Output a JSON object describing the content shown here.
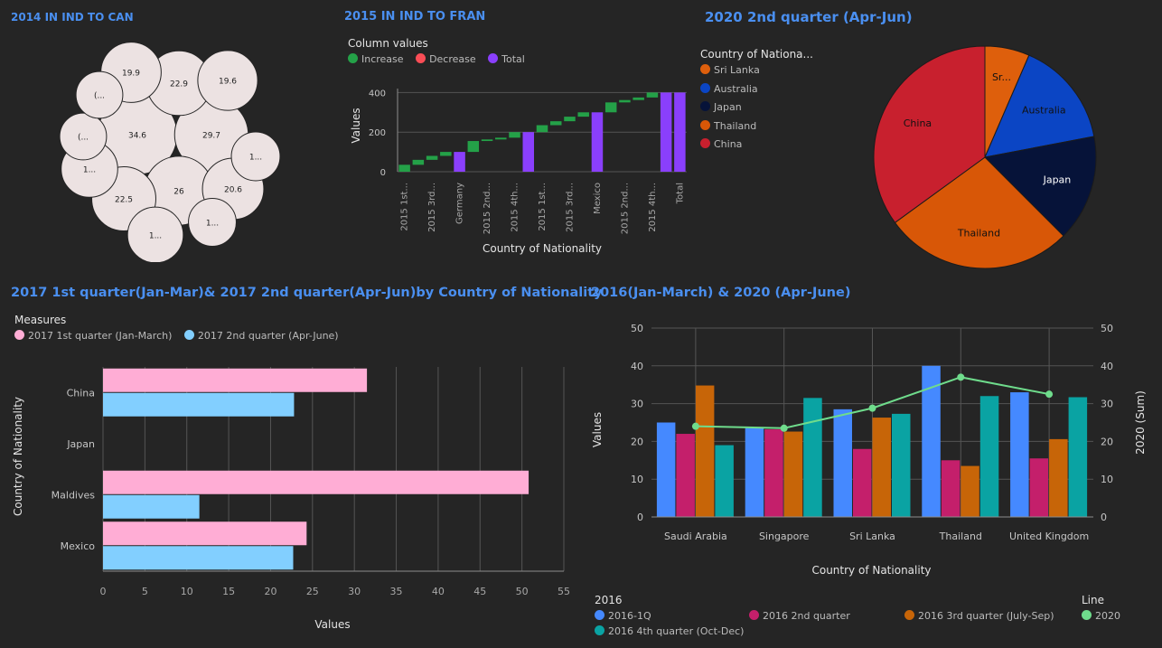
{
  "panels": {
    "bubble": {
      "title": "2014 IN IND TO CAN"
    },
    "waterfall": {
      "title": "2015 IN IND TO FRAN"
    },
    "pie": {
      "title": "2020 2nd quarter (Apr-Jun)"
    },
    "hbar": {
      "title": "2017 1st quarter(Jan-Mar)& 2017 2nd quarter(Apr-Jun)by Country of Nationality"
    },
    "combo": {
      "title": "2016(Jan-March) & 2020  (Apr-June)"
    }
  },
  "chart_data": [
    {
      "id": "bubble",
      "type": "bubble",
      "title": "2014 IN IND TO CAN",
      "bubble_fill": "#ece2e2",
      "bubbles": [
        {
          "label": "34.6",
          "value": 34.6
        },
        {
          "label": "29.7",
          "value": 29.7
        },
        {
          "label": "26",
          "value": 26
        },
        {
          "label": "22.9",
          "value": 22.9
        },
        {
          "label": "22.5",
          "value": 22.5
        },
        {
          "label": "20.6",
          "value": 20.6
        },
        {
          "label": "19.9",
          "value": 19.9
        },
        {
          "label": "19.6",
          "value": 19.6
        },
        {
          "label": "1...",
          "value": 17.5
        },
        {
          "label": "1...",
          "value": 17.0
        },
        {
          "label": "1...",
          "value": 13.0
        },
        {
          "label": "1...",
          "value": 12.5
        },
        {
          "label": "(...",
          "value": 12.0
        },
        {
          "label": "(...",
          "value": 12.0
        }
      ]
    },
    {
      "id": "waterfall",
      "type": "bar",
      "subtype": "waterfall",
      "title": "2015 IN IND TO FRAN",
      "xlabel": "Country of Nationality",
      "ylabel": "Values",
      "ylim": [
        0,
        420
      ],
      "yticks": [
        0,
        200,
        400
      ],
      "legend_title": "Column values",
      "legend": [
        {
          "name": "Increase",
          "color": "#24a148"
        },
        {
          "name": "Decrease",
          "color": "#fa4d56"
        },
        {
          "name": "Total",
          "color": "#8a3ffc"
        }
      ],
      "bars": [
        {
          "kind": "inc",
          "from": 0,
          "to": 35
        },
        {
          "kind": "inc",
          "from": 35,
          "to": 60
        },
        {
          "kind": "inc",
          "from": 60,
          "to": 80
        },
        {
          "kind": "inc",
          "from": 80,
          "to": 100
        },
        {
          "kind": "total",
          "from": 0,
          "to": 100
        },
        {
          "kind": "inc",
          "from": 100,
          "to": 155
        },
        {
          "kind": "inc",
          "from": 155,
          "to": 163
        },
        {
          "kind": "inc",
          "from": 163,
          "to": 172
        },
        {
          "kind": "inc",
          "from": 172,
          "to": 200
        },
        {
          "kind": "total",
          "from": 0,
          "to": 200
        },
        {
          "kind": "inc",
          "from": 200,
          "to": 235
        },
        {
          "kind": "inc",
          "from": 235,
          "to": 255
        },
        {
          "kind": "inc",
          "from": 255,
          "to": 278
        },
        {
          "kind": "inc",
          "from": 278,
          "to": 300
        },
        {
          "kind": "total",
          "from": 0,
          "to": 300
        },
        {
          "kind": "inc",
          "from": 300,
          "to": 350
        },
        {
          "kind": "inc",
          "from": 350,
          "to": 362
        },
        {
          "kind": "inc",
          "from": 362,
          "to": 375
        },
        {
          "kind": "inc",
          "from": 375,
          "to": 400
        },
        {
          "kind": "total",
          "from": 0,
          "to": 400
        },
        {
          "kind": "total",
          "from": 0,
          "to": 400
        }
      ],
      "tick_labels": [
        {
          "i": 0,
          "label": "2015 1st..."
        },
        {
          "i": 2,
          "label": "2015 3rd..."
        },
        {
          "i": 4,
          "label": "Germany"
        },
        {
          "i": 6,
          "label": "2015 2nd..."
        },
        {
          "i": 8,
          "label": "2015 4th..."
        },
        {
          "i": 10,
          "label": "2015 1st..."
        },
        {
          "i": 12,
          "label": "2015 3rd..."
        },
        {
          "i": 14,
          "label": "Mexico"
        },
        {
          "i": 16,
          "label": "2015 2nd..."
        },
        {
          "i": 18,
          "label": "2015 4th..."
        },
        {
          "i": 20,
          "label": "Total"
        }
      ]
    },
    {
      "id": "pie",
      "type": "pie",
      "title": "2020 2nd quarter (Apr-Jun)",
      "legend_title": "Country of Nationa...",
      "slices": [
        {
          "name": "Sri Lanka",
          "label": "Sr...",
          "value": 6.5,
          "color": "#de5f0c"
        },
        {
          "name": "Australia",
          "label": "Australia",
          "value": 15.5,
          "color": "#0b45c4"
        },
        {
          "name": "Japan",
          "label": "Japan",
          "value": 15.5,
          "color": "#061339"
        },
        {
          "name": "Thailand",
          "label": "Thailand",
          "value": 27.5,
          "color": "#d85707"
        },
        {
          "name": "China",
          "label": "China",
          "value": 35.0,
          "color": "#c8202e"
        }
      ]
    },
    {
      "id": "hbar",
      "type": "bar",
      "orientation": "horizontal",
      "title": "2017 1st quarter(Jan-Mar)& 2017 2nd quarter(Apr-Jun)by Country of Nationality",
      "xlabel": "Values",
      "ylabel": "Country of Nationality",
      "xlim": [
        0,
        55
      ],
      "xticks": [
        0,
        5,
        10,
        15,
        20,
        25,
        30,
        35,
        40,
        45,
        50,
        55
      ],
      "legend_title": "Measures",
      "categories": [
        "China",
        "Japan",
        "Maldives",
        "Mexico"
      ],
      "series": [
        {
          "name": "2017 1st quarter (Jan-March)",
          "color": "#ffadd5",
          "values": [
            31.5,
            0,
            50.8,
            24.3
          ]
        },
        {
          "name": "2017 2nd quarter (Apr-June)",
          "color": "#82cfff",
          "values": [
            22.8,
            0,
            11.5,
            22.7
          ]
        }
      ]
    },
    {
      "id": "combo",
      "type": "bar",
      "subtype": "bar-line combo",
      "title": "2016(Jan-March) & 2020  (Apr-June)",
      "xlabel": "Country of Nationality",
      "ylabel": "Values",
      "y2label": "2020 (Sum)",
      "ylim": [
        0,
        50
      ],
      "yticks": [
        0,
        10,
        20,
        30,
        40,
        50
      ],
      "categories": [
        "Saudi Arabia",
        "Singapore",
        "Sri Lanka",
        "Thailand",
        "United Kingdom"
      ],
      "legend_title": "2016",
      "legend2_title": "Line",
      "series": [
        {
          "name": "2016-1Q",
          "color": "#4589ff",
          "values": [
            25,
            23.5,
            28.5,
            40,
            33
          ]
        },
        {
          "name": "2016 2nd quarter",
          "color": "#c41f6b",
          "values": [
            22,
            23.2,
            18,
            15,
            15.5
          ]
        },
        {
          "name": "2016 3rd quarter (July-Sep)",
          "color": "#c76508",
          "values": [
            34.8,
            22.6,
            26.3,
            13.5,
            20.6
          ]
        },
        {
          "name": "2016 4th quarter (Oct-Dec)",
          "color": "#0aa3a3",
          "values": [
            19,
            31.5,
            27.3,
            32,
            31.7
          ]
        }
      ],
      "line": {
        "name": "2020",
        "color": "#6fdc8c",
        "values": [
          24,
          23.5,
          28.8,
          37,
          32.5
        ]
      }
    }
  ]
}
